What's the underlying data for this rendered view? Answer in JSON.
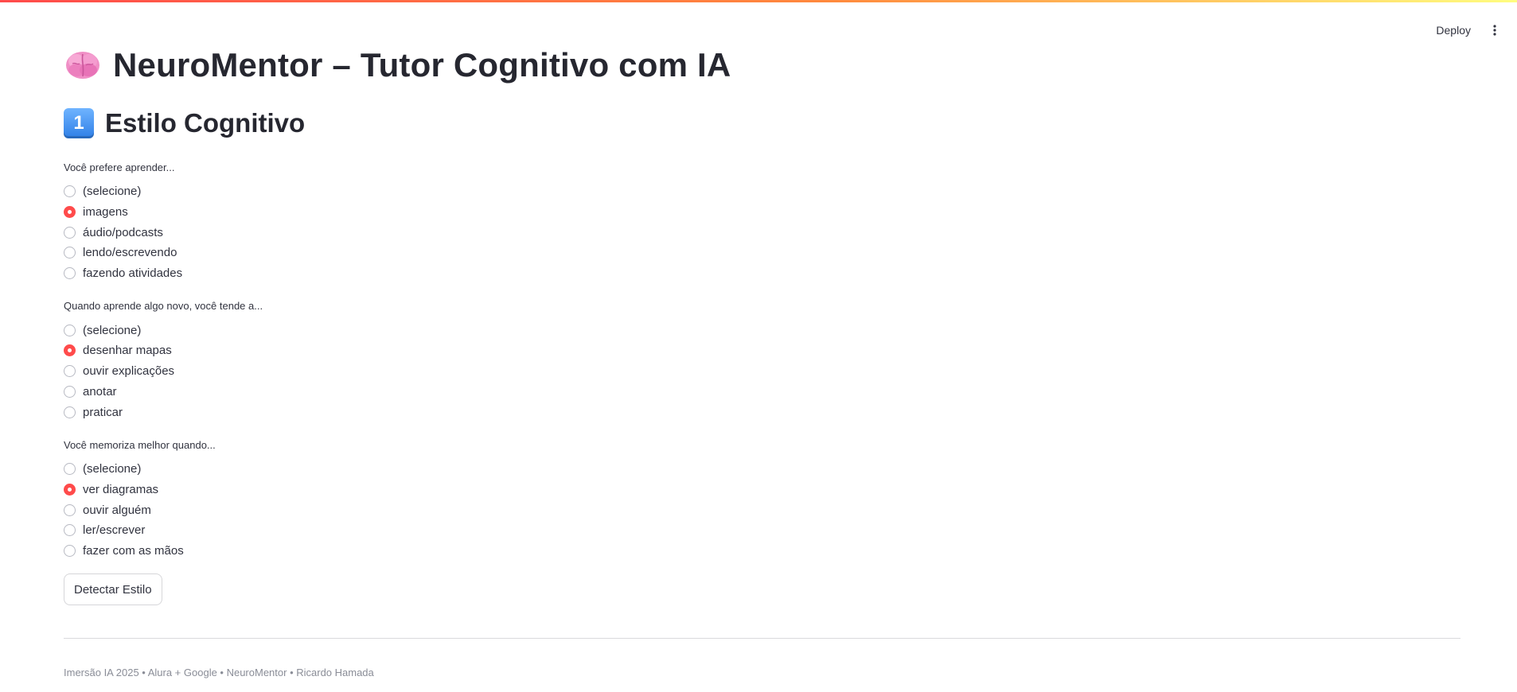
{
  "toolbar": {
    "deploy_label": "Deploy",
    "menu_icon": "more-vertical-icon"
  },
  "header": {
    "title": "NeuroMentor – Tutor Cognitivo com IA",
    "title_icon": "brain-icon"
  },
  "section": {
    "keycap": "1",
    "keycap_icon": "keycap-one-icon",
    "title": "Estilo Cognitivo"
  },
  "questions": [
    {
      "label": "Você prefere aprender...",
      "options": [
        "(selecione)",
        "imagens",
        "áudio/podcasts",
        "lendo/escrevendo",
        "fazendo atividades"
      ],
      "selected": "imagens"
    },
    {
      "label": "Quando aprende algo novo, você tende a...",
      "options": [
        "(selecione)",
        "desenhar mapas",
        "ouvir explicações",
        "anotar",
        "praticar"
      ],
      "selected": "desenhar mapas"
    },
    {
      "label": "Você memoriza melhor quando...",
      "options": [
        "(selecione)",
        "ver diagramas",
        "ouvir alguém",
        "ler/escrever",
        "fazer com as mãos"
      ],
      "selected": "ver diagramas"
    }
  ],
  "actions": {
    "detect_label": "Detectar Estilo"
  },
  "footer": {
    "text": "Imersão IA 2025 • Alura + Google • NeuroMentor • Ricardo Hamada"
  },
  "colors": {
    "accent": "#ff4b4b",
    "keycap": "#2f7fe6",
    "text": "#31333f"
  }
}
